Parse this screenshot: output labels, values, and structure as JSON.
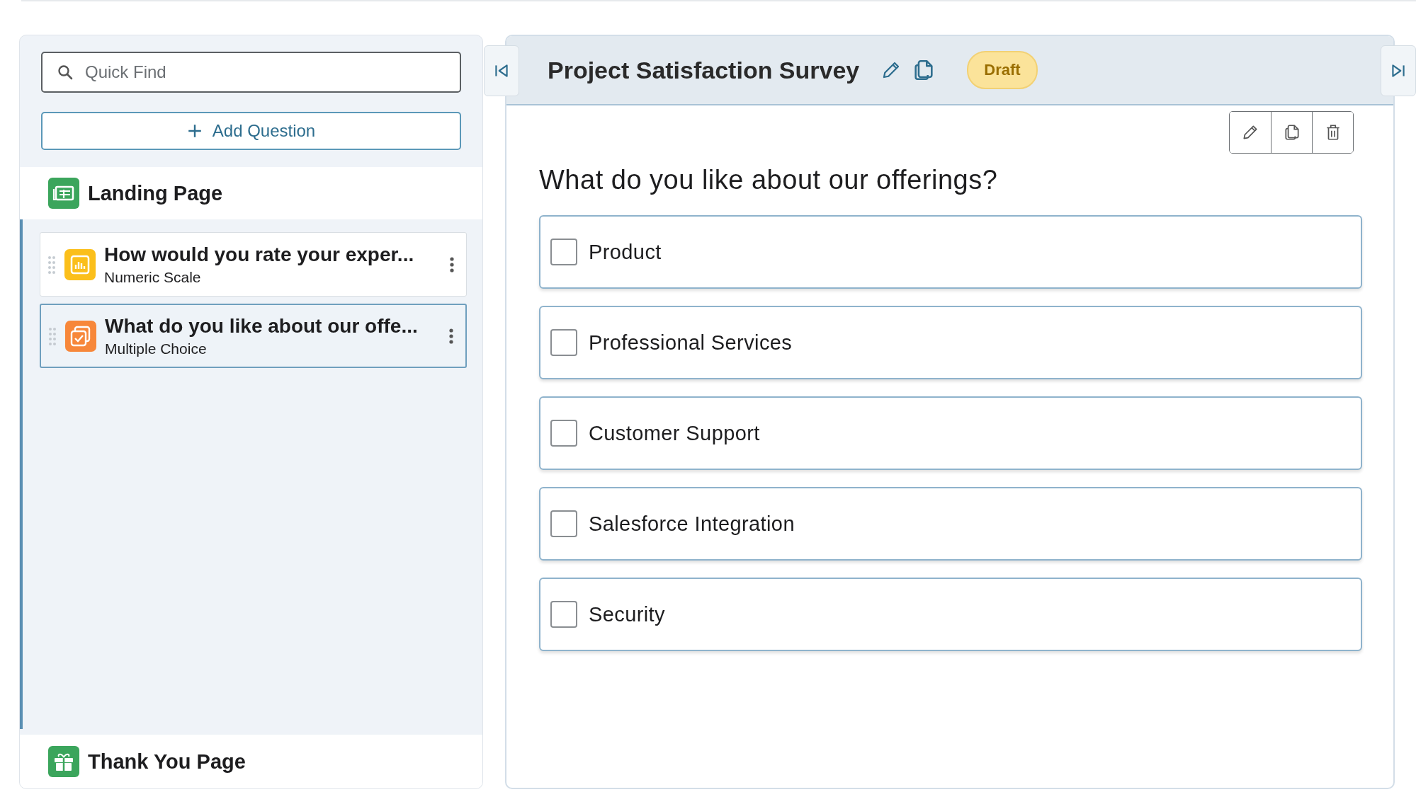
{
  "sidebar": {
    "search": {
      "placeholder": "Quick Find"
    },
    "add_button": "Add Question",
    "landing": "Landing Page",
    "questions": [
      {
        "title": "How would you rate your exper...",
        "type": "Numeric Scale",
        "kind": "scale",
        "selected": false
      },
      {
        "title": "What do you like about our offe...",
        "type": "Multiple Choice",
        "kind": "choice",
        "selected": true
      }
    ],
    "thank_you": "Thank You Page"
  },
  "survey": {
    "title": "Project Satisfaction Survey",
    "status": "Draft",
    "question": "What do you like about our offerings?",
    "options": [
      {
        "label": "Product",
        "checked": false
      },
      {
        "label": "Professional Services",
        "checked": false
      },
      {
        "label": "Customer Support",
        "checked": false
      },
      {
        "label": "Salesforce Integration",
        "checked": false
      },
      {
        "label": "Security",
        "checked": false
      }
    ]
  }
}
